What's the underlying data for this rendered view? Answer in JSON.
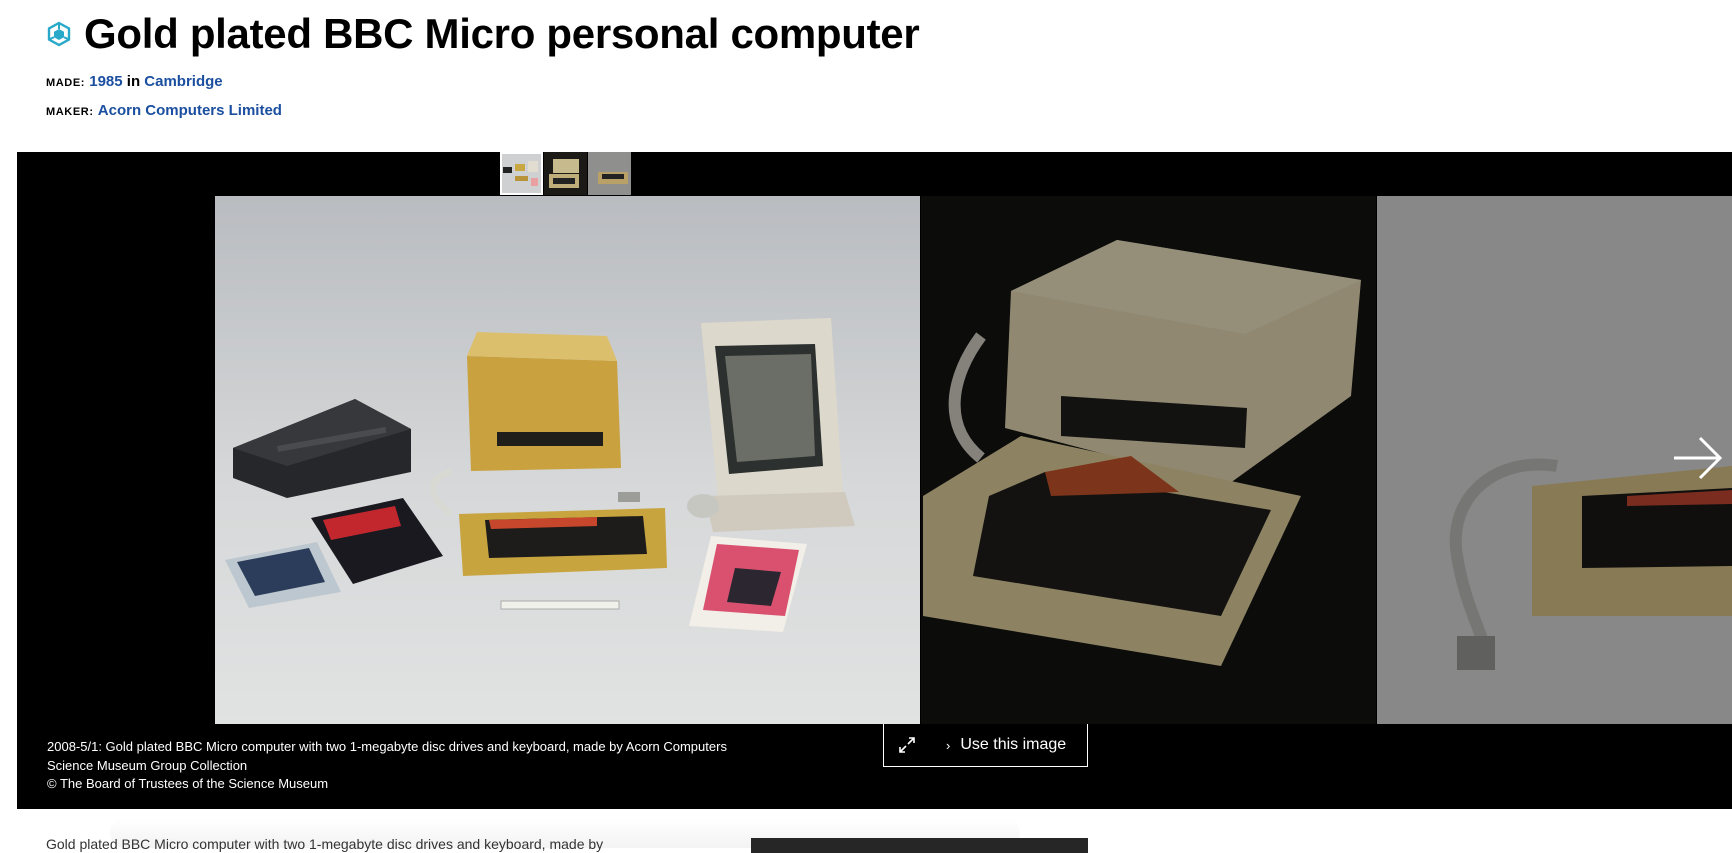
{
  "object": {
    "title": "Gold plated BBC Micro personal computer",
    "made_label": "MADE:",
    "made_year": "1985",
    "made_in": "in",
    "made_place": "Cambridge",
    "maker_label": "MAKER:",
    "maker_name": "Acorn Computers Limited",
    "icon": "3d-cube-icon",
    "accent_color": "#29a9c9",
    "link_color": "#1b4fa0"
  },
  "viewer": {
    "thumbnails": [
      {
        "name": "thumbnail-1",
        "active": true
      },
      {
        "name": "thumbnail-2",
        "active": false
      },
      {
        "name": "thumbnail-3",
        "active": false
      }
    ],
    "next_icon": "arrow-right-icon",
    "caption_line1": "2008-5/1: Gold plated BBC Micro computer with two 1-megabyte disc drives and keyboard, made by Acorn Computers",
    "caption_line2": "Science Museum Group Collection",
    "caption_line3": "© The Board of Trustees of the Science Museum",
    "expand_icon": "expand-icon",
    "use_image_label": "Use this image",
    "background_color": "#000000"
  },
  "description": {
    "text": "Gold plated BBC Micro computer with two 1-megabyte disc drives and keyboard, made by"
  }
}
